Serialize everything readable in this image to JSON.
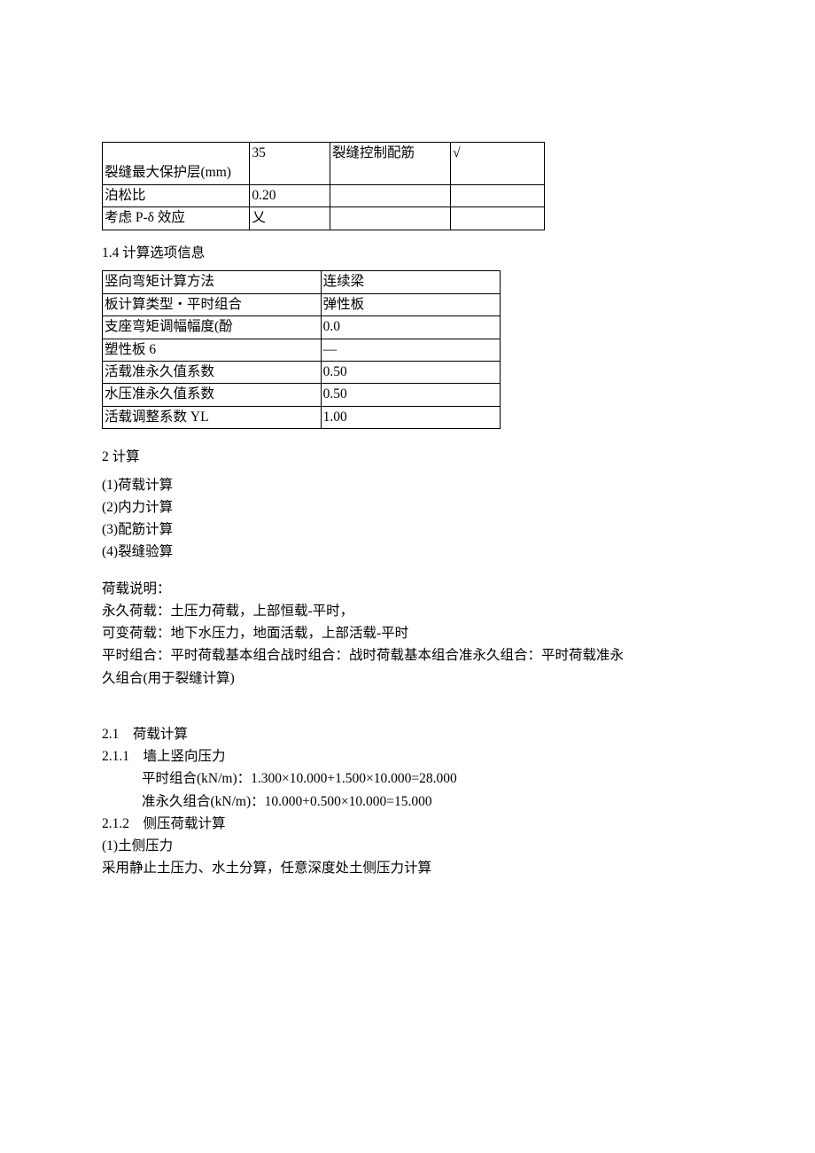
{
  "table1": {
    "rows": [
      {
        "a": "裂缝最大保护层(mm)",
        "b": "35",
        "c": "裂缝控制配筋",
        "d": "√"
      },
      {
        "a": "泊松比",
        "b": "0.20",
        "c": "",
        "d": ""
      },
      {
        "a": "考虑 P-δ 效应",
        "b": "乂",
        "c": "",
        "d": ""
      }
    ]
  },
  "section14": {
    "title": "1.4 计算选项信息",
    "rows": [
      {
        "a": "竖向弯矩计算方法",
        "b": "连续梁"
      },
      {
        "a": "板计算类型・平时组合",
        "b": "弹性板"
      },
      {
        "a": "支座弯矩调幅幅度(酚",
        "b": "0.0"
      },
      {
        "a": "塑性板 6",
        "b": "—"
      },
      {
        "a": "活载准永久值系数",
        "b": "0.50"
      },
      {
        "a": "水压准永久值系数",
        "b": "0.50"
      },
      {
        "a": "活载调整系数 YL",
        "b": "1.00"
      }
    ]
  },
  "section2": {
    "title": "2 计算",
    "items": [
      "(1)荷载计算",
      "(2)内力计算",
      "(3)配筋计算",
      "(4)裂缝验算"
    ],
    "load_label": "荷载说明：",
    "loads": [
      "永久荷载：土压力荷载，上部恒载-平时，",
      "可变荷载：地下水压力，地面活载，上部活载-平时",
      "平时组合：平时荷载基本组合战时组合：战时荷载基本组合准永久组合：平时荷载准永",
      "久组合(用于裂缝计算)"
    ]
  },
  "section21": {
    "title": "2.1　荷载计算",
    "s211": {
      "title": "2.1.1　墙上竖向压力",
      "lines": [
        "平时组合(kN/m)：1.300×10.000+1.500×10.000=28.000",
        "准永久组合(kN/m)：10.000+0.500×10.000=15.000"
      ]
    },
    "s212": {
      "title": "2.1.2　侧压荷载计算",
      "sub": "(1)土侧压力",
      "desc": "采用静止土压力、水土分算，任意深度处土侧压力计算"
    }
  }
}
